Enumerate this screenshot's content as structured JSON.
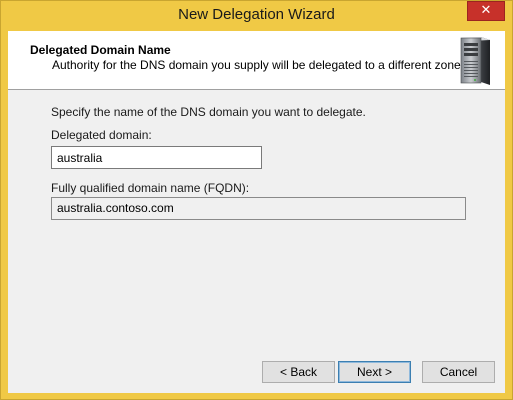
{
  "window": {
    "title": "New Delegation Wizard",
    "close_glyph": "✕",
    "colors": {
      "frame": "#f0c945",
      "close": "#c7312a",
      "client": "#f0f0f0"
    }
  },
  "header": {
    "title": "Delegated Domain Name",
    "subtitle": "Authority for the DNS domain you supply will be delegated to a different zone.",
    "icon": "server-icon"
  },
  "content": {
    "instruction": "Specify the name of the DNS domain you want to delegate.",
    "delegated_domain": {
      "label": "Delegated domain:",
      "value": "australia"
    },
    "fqdn": {
      "label": "Fully qualified domain name (FQDN):",
      "value": "australia.contoso.com"
    }
  },
  "buttons": {
    "back": "< Back",
    "next": "Next >",
    "cancel": "Cancel"
  }
}
